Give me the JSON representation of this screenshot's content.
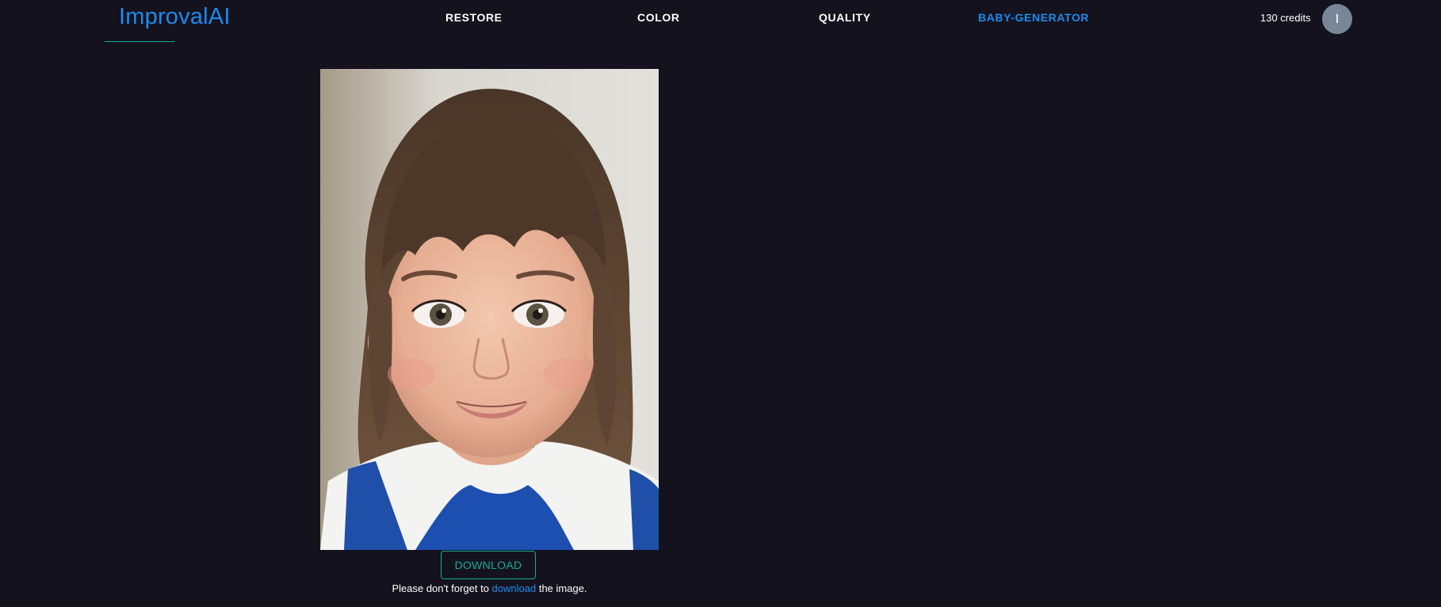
{
  "header": {
    "logo": "ImprovalAI",
    "nav": [
      {
        "label": "RESTORE"
      },
      {
        "label": "COLOR"
      },
      {
        "label": "QUALITY"
      },
      {
        "label": "BABY-GENERATOR",
        "active": true
      }
    ],
    "credits": "130 credits",
    "avatar_initial": "I"
  },
  "result": {
    "download_label": "DOWNLOAD",
    "note_before": "Please don't forget to",
    "note_link": "download",
    "note_after": "the image."
  },
  "colors": {
    "background": "#13121d",
    "accent_blue": "#1a8cf0",
    "accent_teal": "#14a99a",
    "avatar": "#778797"
  },
  "icons": {
    "avatar": "user-avatar"
  }
}
